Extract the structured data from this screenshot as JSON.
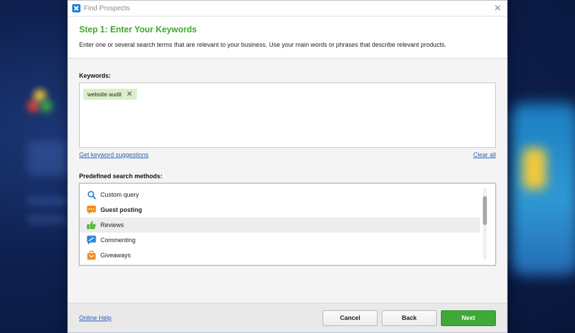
{
  "window": {
    "title": "Find Prospects"
  },
  "header": {
    "step_title": "Step 1: Enter Your Keywords",
    "description": "Enter one or several search terms that are relevant to your business. Use your main words or phrases that describe relevant products."
  },
  "keywords": {
    "label": "Keywords:",
    "chips": [
      "website audit"
    ],
    "suggest_link": "Get keyword suggestions",
    "clear_link": "Clear all"
  },
  "methods": {
    "label": "Predefined search methods:",
    "items": [
      {
        "label": "Custom query",
        "icon": "search-icon",
        "bold": false,
        "selected": false
      },
      {
        "label": "Guest posting",
        "icon": "chat-bubble-icon",
        "bold": true,
        "selected": false
      },
      {
        "label": "Reviews",
        "icon": "thumbs-up-icon",
        "bold": false,
        "selected": true
      },
      {
        "label": "Commenting",
        "icon": "comment-icon",
        "bold": false,
        "selected": false
      },
      {
        "label": "Giveaways",
        "icon": "gift-bag-icon",
        "bold": false,
        "selected": false
      }
    ]
  },
  "footer": {
    "help_link": "Online Help",
    "cancel_label": "Cancel",
    "back_label": "Back",
    "next_label": "Next"
  },
  "colors": {
    "accent_green": "#3fa82b",
    "link_blue": "#2b5fb7",
    "button_green": "#3ea838"
  }
}
